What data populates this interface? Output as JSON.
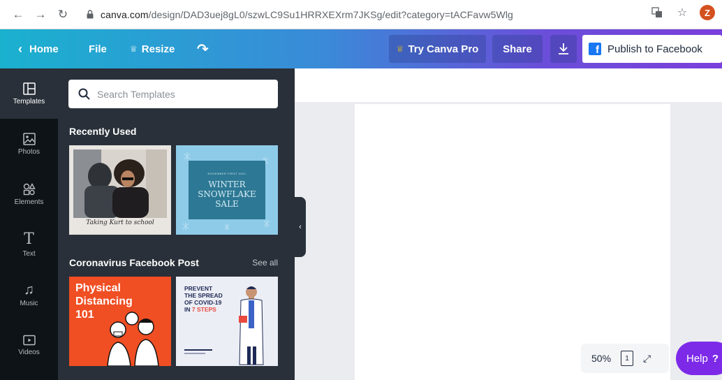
{
  "browser": {
    "url_host": "canva.com",
    "url_path": "/design/DAD3uej8gL0/szwLC9Su1HRRXEXrm7JKSg/edit?category=tACFavw5Wlg",
    "avatar_letter": "Z"
  },
  "header": {
    "home_label": "Home",
    "file_label": "File",
    "resize_label": "Resize",
    "try_pro_label": "Try Canva Pro",
    "share_label": "Share",
    "publish_label": "Publish to Facebook"
  },
  "rail": {
    "items": [
      {
        "label": "Templates",
        "icon": "templates-icon"
      },
      {
        "label": "Photos",
        "icon": "photos-icon"
      },
      {
        "label": "Elements",
        "icon": "elements-icon"
      },
      {
        "label": "Text",
        "icon": "text-icon"
      },
      {
        "label": "Music",
        "icon": "music-icon"
      },
      {
        "label": "Videos",
        "icon": "videos-icon"
      }
    ]
  },
  "panel": {
    "search_placeholder": "Search Templates",
    "recently_used_title": "Recently Used",
    "category_title": "Coronavirus Facebook Post",
    "see_all_label": "See all",
    "templates": {
      "t1_caption": "Taking Kurt to school",
      "t2_subtitle": "NOVEMBER FIRST 2021",
      "t2_title": "WINTER SNOWFLAKE SALE",
      "t3_title": "Physical Distancing 101",
      "t4_title_a": "PREVENT",
      "t4_title_b": "THE SPREAD",
      "t4_title_c": "OF COVID-19",
      "t4_title_d": "IN",
      "t4_title_e": "7 STEPS"
    }
  },
  "canvas": {
    "zoom_label": "50%",
    "page_count": "1",
    "help_label": "Help",
    "help_mark": "?"
  },
  "colors": {
    "accent_purple": "#7d2ae8",
    "panel_bg": "#293039",
    "rail_bg": "#0e1318",
    "facebook_blue": "#1877f2"
  }
}
